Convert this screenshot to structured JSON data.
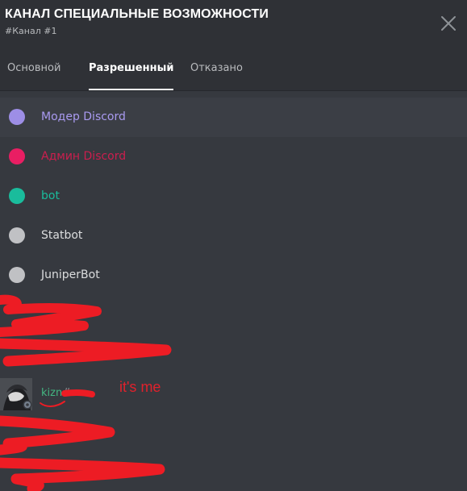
{
  "header": {
    "title": "КАНАЛ СПЕЦИАЛЬНЫЕ ВОЗМОЖНОСТИ",
    "subtitle": "#Канал #1"
  },
  "tabs": [
    {
      "label": "Основной",
      "active": false
    },
    {
      "label": "Разрешенный",
      "active": true
    },
    {
      "label": "Отказано",
      "active": false
    }
  ],
  "roles": [
    {
      "label": "Модер Discord",
      "color": "#9d8ee6",
      "label_color": "#a99af0"
    },
    {
      "label": "Админ Discord",
      "color": "#e91e63",
      "label_color": "#cc1e4e"
    },
    {
      "label": "bot",
      "color": "#1abc9c",
      "label_color": "#1abc9c"
    },
    {
      "label": "Statbot",
      "color": "#c0c1c4",
      "label_color": "#dcddde"
    },
    {
      "label": "JuniperBot",
      "color": "#c0c1c4",
      "label_color": "#dcddde"
    }
  ],
  "user": {
    "name": "kizn",
    "suffix": "#",
    "name_color": "#43b581"
  },
  "annotation": "it's me",
  "colors": {
    "background": "#36393f",
    "header_bg": "#2f3136",
    "redaction": "#ed1c24"
  }
}
